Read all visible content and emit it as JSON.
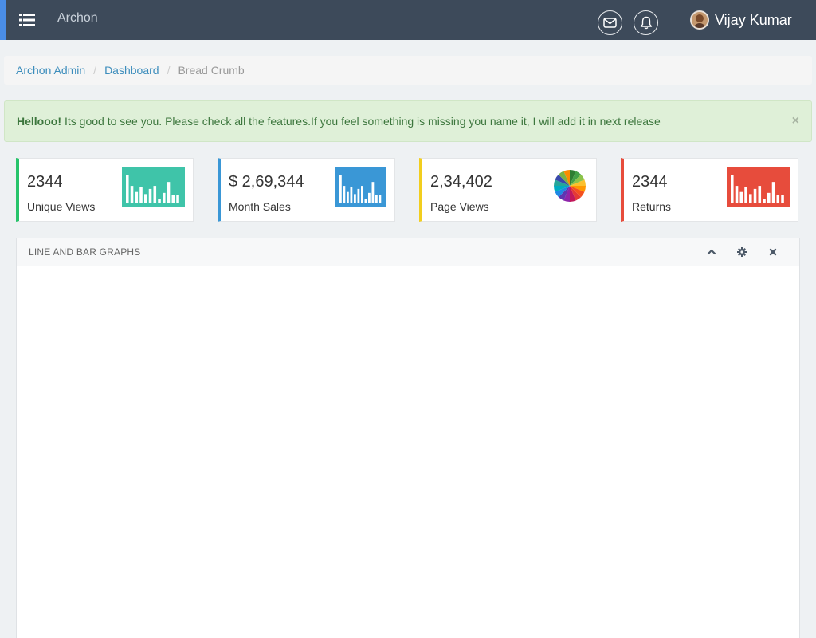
{
  "app": {
    "title": "Archon"
  },
  "user": {
    "name": "Vijay Kumar"
  },
  "breadcrumb": {
    "items": [
      "Archon Admin",
      "Dashboard"
    ],
    "active": "Bread Crumb"
  },
  "alert": {
    "strong": "Hellooo!",
    "message": "Its good to see you. Please check all the features.If you feel something is missing you name it, I will add it in next release",
    "close": "×"
  },
  "cards": [
    {
      "value": "2344",
      "label": "Unique Views",
      "color": "#27c46b",
      "chart_color": "#3fc4a9"
    },
    {
      "value": "$ 2,69,344",
      "label": "Month Sales",
      "color": "#3a97d6",
      "chart_color": "#3a97d6"
    },
    {
      "value": "2,34,402",
      "label": "Page Views",
      "color": "#f2ce1e",
      "chart_color": "pie"
    },
    {
      "value": "2344",
      "label": "Returns",
      "color": "#e74c3c",
      "chart_color": "#e74c3c"
    }
  ],
  "panel": {
    "title": "LINE AND BAR GRAPHS"
  },
  "icons": {
    "menu": "list-icon",
    "mail": "envelope-icon",
    "notifications": "bell-icon",
    "collapse": "chevron-up-icon",
    "settings": "gear-icon",
    "close": "close-icon"
  }
}
